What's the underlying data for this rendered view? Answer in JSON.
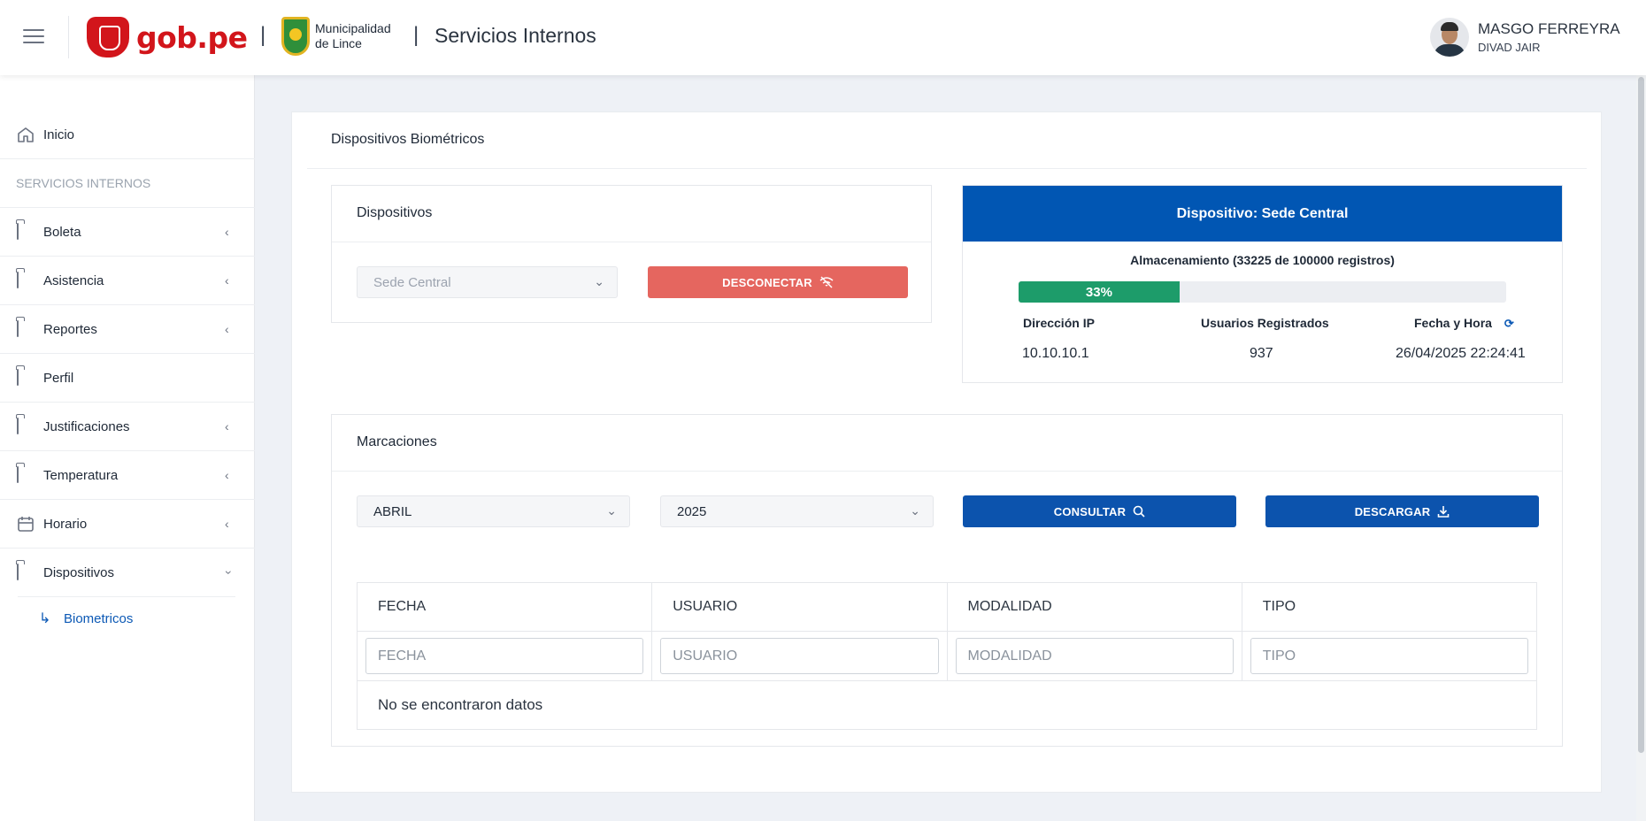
{
  "header": {
    "gob_logo": "gob.pe",
    "separator": "|",
    "municipality_line1": "Municipalidad",
    "municipality_line2": "de Lince",
    "app_title": "Servicios Internos",
    "user_name": "MASGO FERREYRA",
    "user_sub": "DIVAD JAIR"
  },
  "sidebar": {
    "home": "Inicio",
    "section": "SERVICIOS INTERNOS",
    "items": [
      {
        "label": "Boleta",
        "icon": "folder-plus-icon",
        "expandable": true
      },
      {
        "label": "Asistencia",
        "icon": "folder-plus-icon",
        "expandable": true
      },
      {
        "label": "Reportes",
        "icon": "folder-plus-icon",
        "expandable": true
      },
      {
        "label": "Perfil",
        "icon": "folder-icon",
        "expandable": false
      },
      {
        "label": "Justificaciones",
        "icon": "folder-plus-icon",
        "expandable": true
      },
      {
        "label": "Temperatura",
        "icon": "folder-plus-icon",
        "expandable": true
      },
      {
        "label": "Horario",
        "icon": "calendar-icon",
        "expandable": true
      },
      {
        "label": "Dispositivos",
        "icon": "folder-plus-icon",
        "expandable": true,
        "expanded": true
      }
    ],
    "subitem": "Biometricos",
    "accent": "#0c59b5"
  },
  "page": {
    "title": "Dispositivos Biométricos"
  },
  "devices": {
    "title": "Dispositivos",
    "selected_device": "Sede Central",
    "disconnect_label": "DESCONECTAR",
    "disconnect_color": "#e5665f"
  },
  "device_info": {
    "header": "Dispositivo: Sede Central",
    "header_color": "#0156b3",
    "storage_label": "Almacenamiento (33225 de 100000 registros)",
    "storage_percent": 33,
    "storage_percent_label": "33%",
    "ip_label": "Dirección IP",
    "ip_value": "10.10.10.1",
    "users_label": "Usuarios Registrados",
    "users_value": "937",
    "datetime_label": "Fecha y Hora",
    "datetime_value": "26/04/2025 22:24:41"
  },
  "marks": {
    "title": "Marcaciones",
    "month": "ABRIL",
    "year": "2025",
    "query_label": "CONSULTAR",
    "download_label": "DESCARGAR",
    "columns": [
      "FECHA",
      "USUARIO",
      "MODALIDAD",
      "TIPO"
    ],
    "filters": [
      "FECHA",
      "USUARIO",
      "MODALIDAD",
      "TIPO"
    ],
    "empty_text": "No se encontraron datos"
  }
}
